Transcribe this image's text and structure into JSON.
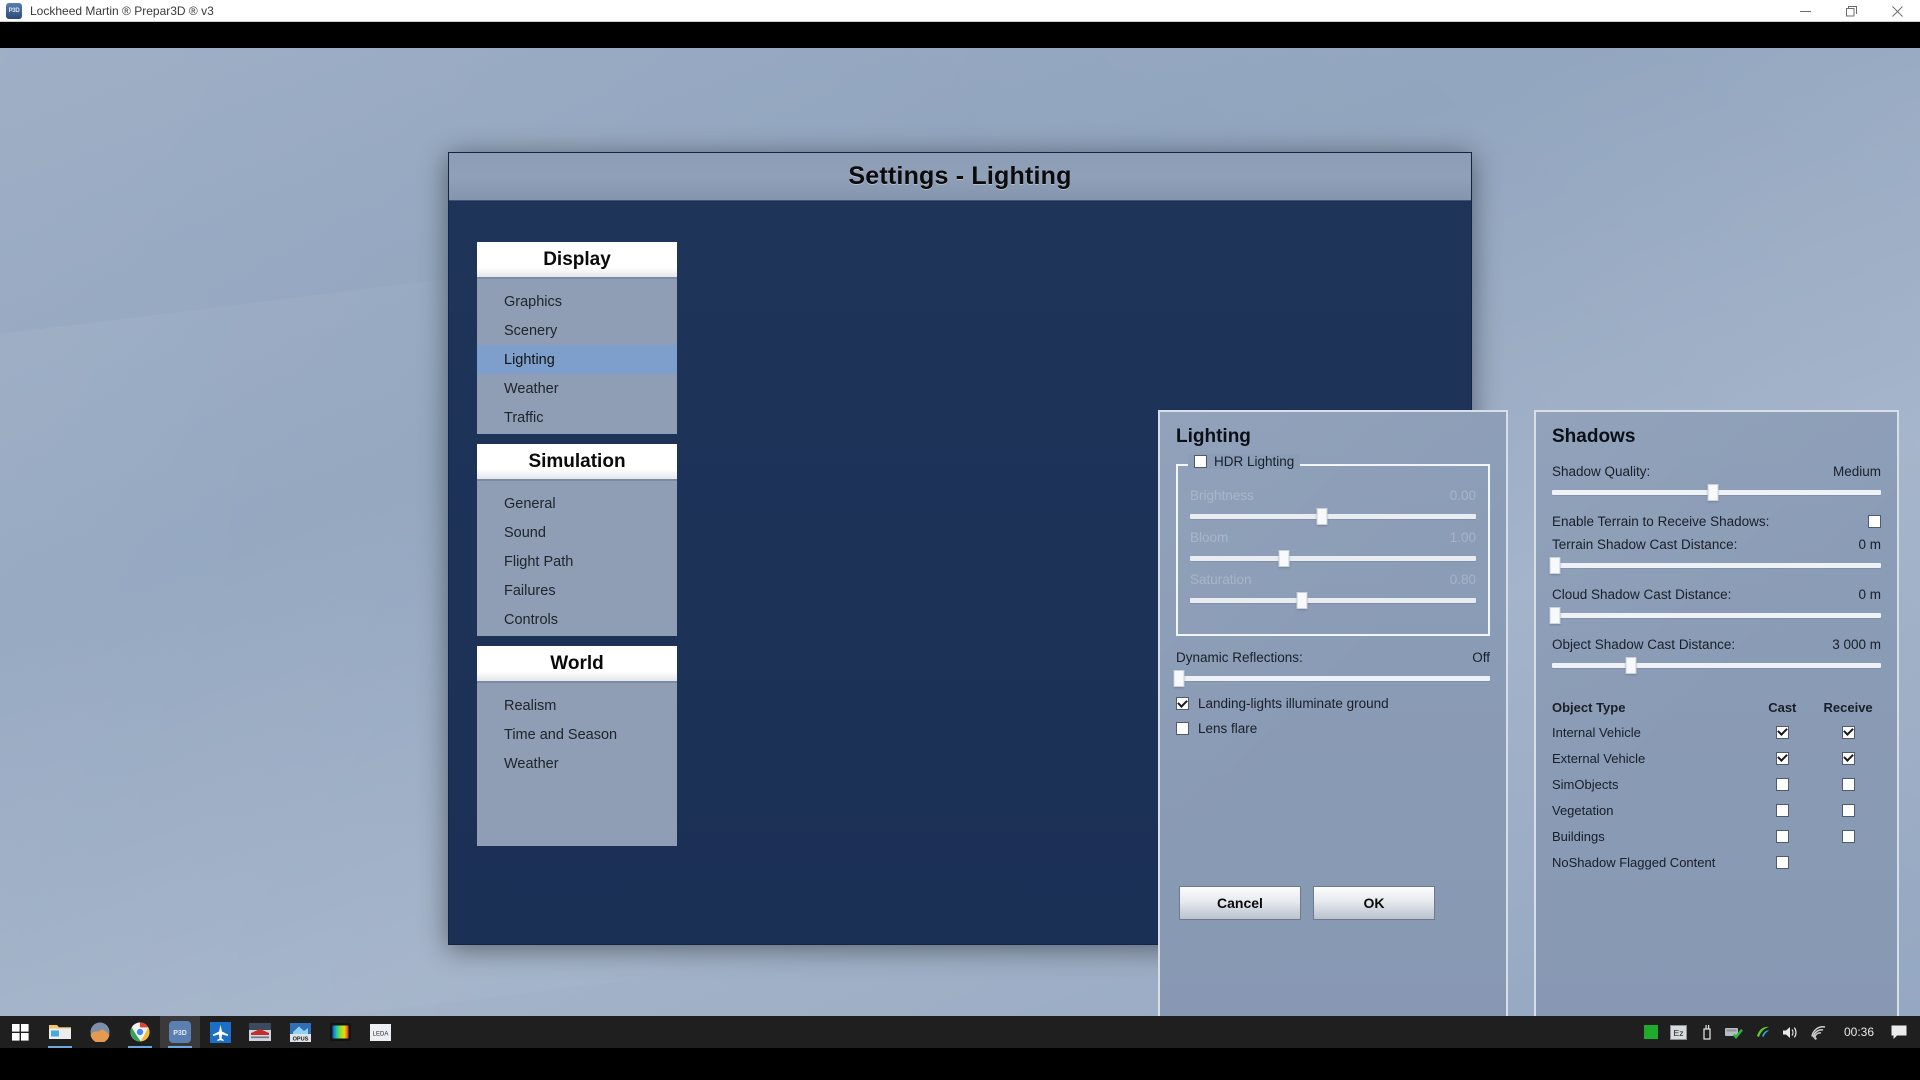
{
  "window": {
    "title": "Lockheed Martin ® Prepar3D ® v3",
    "icon": "p3d-app-icon",
    "controls": [
      {
        "name": "minimize-button",
        "glyph": "minimize-icon"
      },
      {
        "name": "maximize-button",
        "glyph": "restore-icon"
      },
      {
        "name": "close-button",
        "glyph": "close-icon"
      }
    ]
  },
  "dialog": {
    "title": "Settings - Lighting",
    "buttons": {
      "cancel": "Cancel",
      "ok": "OK"
    }
  },
  "sidebar": {
    "groups": [
      {
        "header": "Display",
        "items": [
          {
            "label": "Graphics",
            "active": false
          },
          {
            "label": "Scenery",
            "active": false
          },
          {
            "label": "Lighting",
            "active": true
          },
          {
            "label": "Weather",
            "active": false
          },
          {
            "label": "Traffic",
            "active": false
          }
        ]
      },
      {
        "header": "Simulation",
        "items": [
          {
            "label": "General",
            "active": false
          },
          {
            "label": "Sound",
            "active": false
          },
          {
            "label": "Flight Path",
            "active": false
          },
          {
            "label": "Failures",
            "active": false
          },
          {
            "label": "Controls",
            "active": false
          }
        ]
      },
      {
        "header": "World",
        "items": [
          {
            "label": "Realism",
            "active": false
          },
          {
            "label": "Time and Season",
            "active": false
          },
          {
            "label": "Weather",
            "active": false
          }
        ]
      }
    ]
  },
  "lighting_panel": {
    "title": "Lighting",
    "hdr_group": {
      "legend_label": "HDR Lighting",
      "checked": false,
      "enabled": false,
      "sliders": [
        {
          "label": "Brightness",
          "value": "0.00",
          "percent": 46
        },
        {
          "label": "Bloom",
          "value": "1.00",
          "percent": 33
        },
        {
          "label": "Saturation",
          "value": "0.80",
          "percent": 39
        }
      ]
    },
    "dynamic_reflections": {
      "label": "Dynamic Reflections:",
      "value": "Off",
      "percent": 1
    },
    "checkboxes": [
      {
        "label": "Landing-lights illuminate ground",
        "checked": true
      },
      {
        "label": "Lens flare",
        "checked": false
      }
    ]
  },
  "shadows_panel": {
    "title": "Shadows",
    "shadow_quality": {
      "label": "Shadow Quality:",
      "value": "Medium",
      "percent": 49
    },
    "terrain_receive": {
      "label": "Enable Terrain to Receive Shadows:",
      "checked": false
    },
    "distance_sliders": [
      {
        "label": "Terrain Shadow Cast Distance:",
        "value": "0 m",
        "percent": 1
      },
      {
        "label": "Cloud Shadow Cast Distance:",
        "value": "0 m",
        "percent": 1
      },
      {
        "label": "Object Shadow Cast Distance:",
        "value": "3 000 m",
        "percent": 24
      }
    ],
    "object_table": {
      "headers": [
        "Object Type",
        "Cast",
        "Receive"
      ],
      "rows": [
        {
          "type": "Internal Vehicle",
          "cast": true,
          "receive": true,
          "has_receive": true
        },
        {
          "type": "External Vehicle",
          "cast": true,
          "receive": true,
          "has_receive": true
        },
        {
          "type": "SimObjects",
          "cast": false,
          "receive": false,
          "has_receive": true
        },
        {
          "type": "Vegetation",
          "cast": false,
          "receive": false,
          "has_receive": true
        },
        {
          "type": "Buildings",
          "cast": false,
          "receive": false,
          "has_receive": true
        },
        {
          "type": "NoShadow Flagged Content",
          "cast": false,
          "receive": false,
          "has_receive": false
        }
      ]
    }
  },
  "taskbar": {
    "items": [
      {
        "name": "start-button",
        "icon": "windows-logo-icon"
      },
      {
        "name": "file-explorer",
        "icon": "folder-icon"
      },
      {
        "name": "photos-app",
        "icon": "photos-icon"
      },
      {
        "name": "chrome-browser",
        "icon": "chrome-icon"
      },
      {
        "name": "prepar3d-app",
        "icon": "p3d-icon"
      },
      {
        "name": "flight-planner",
        "icon": "airplane-icon"
      },
      {
        "name": "navigraph-app",
        "icon": "nav-chart-icon"
      },
      {
        "name": "opus-app",
        "icon": "opus-icon"
      },
      {
        "name": "color-tool",
        "icon": "gradient-icon"
      },
      {
        "name": "leda-app",
        "icon": "leda-icon"
      }
    ],
    "tray": [
      {
        "name": "green-status-icon",
        "icon": "square-icon"
      },
      {
        "name": "ez-dok-icon",
        "icon": "ez-icon"
      },
      {
        "name": "usb-safe-remove-icon",
        "icon": "usb-icon"
      },
      {
        "name": "network-ok-icon",
        "icon": "network-check-icon"
      },
      {
        "name": "nvidia-icon",
        "icon": "nvidia-icon"
      },
      {
        "name": "volume-icon",
        "icon": "speaker-icon"
      },
      {
        "name": "wifi-icon",
        "icon": "wifi-icon"
      }
    ],
    "clock": "00:36",
    "action_center": "notification-icon"
  },
  "colors": {
    "dialog_border": "#1b3056",
    "panel_bg": "#8b9cb6",
    "nav_active": "#7e9fcb",
    "nav_bg": "#8f9eb5",
    "title_bar": "#90a0b8",
    "taskbar": "#1f1f1f"
  }
}
